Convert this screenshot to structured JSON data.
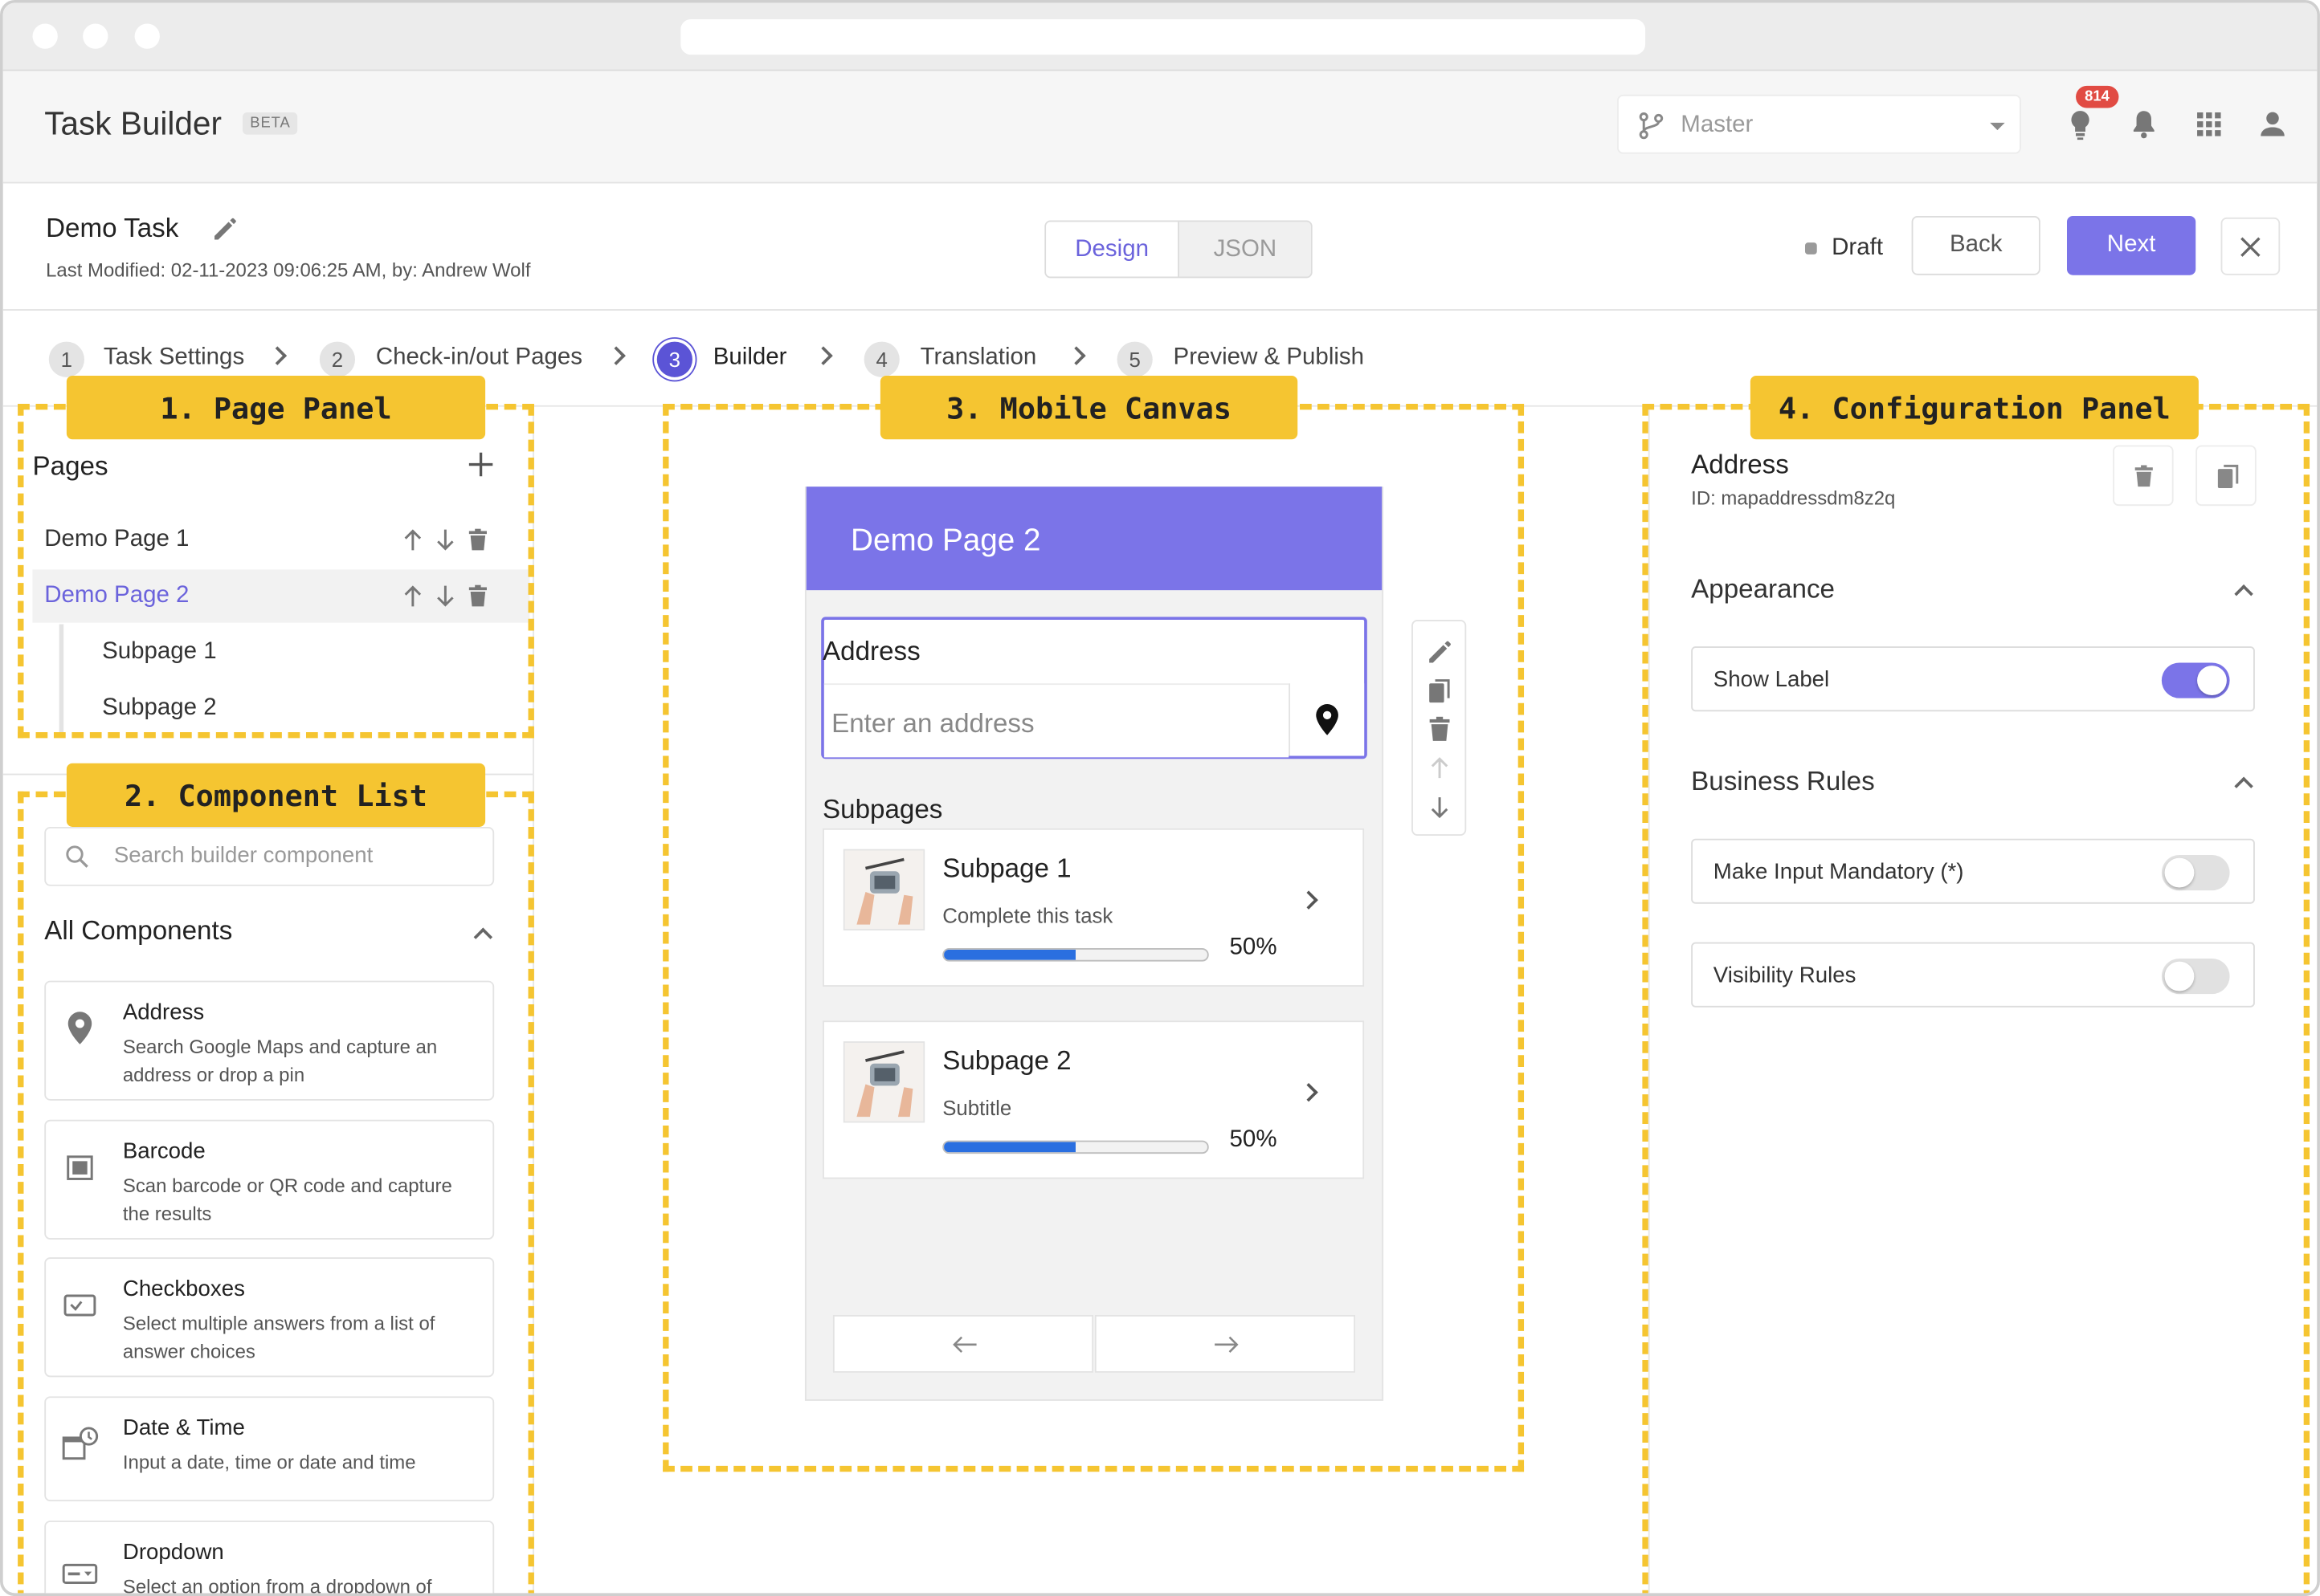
{
  "app": {
    "title": "Task Builder",
    "beta": "BETA",
    "branch": "Master",
    "notification_count": "814"
  },
  "task": {
    "name": "Demo Task",
    "last_modified": "Last Modified: 02-11-2023 09:06:25 AM, by: Andrew Wolf",
    "status": "Draft"
  },
  "view_toggle": {
    "design": "Design",
    "json": "JSON"
  },
  "actions": {
    "back": "Back",
    "next": "Next"
  },
  "steps": [
    {
      "num": "1",
      "label": "Task Settings"
    },
    {
      "num": "2",
      "label": "Check-in/out Pages"
    },
    {
      "num": "3",
      "label": "Builder"
    },
    {
      "num": "4",
      "label": "Translation"
    },
    {
      "num": "5",
      "label": "Preview & Publish"
    }
  ],
  "callouts": {
    "page_panel": "1. Page Panel",
    "component_list": "2. Component List",
    "mobile_canvas": "3. Mobile Canvas",
    "config_panel": "4. Configuration Panel"
  },
  "page_panel": {
    "title": "Pages",
    "pages": [
      {
        "label": "Demo Page 1"
      },
      {
        "label": "Demo Page 2"
      }
    ],
    "subpages": [
      {
        "label": "Subpage 1"
      },
      {
        "label": "Subpage 2"
      }
    ]
  },
  "component_list": {
    "search_placeholder": "Search builder component",
    "section_title": "All Components",
    "items": [
      {
        "title": "Address",
        "desc": "Search Google Maps and capture an address or drop a pin",
        "icon": "map-pin-icon"
      },
      {
        "title": "Barcode",
        "desc": "Scan barcode or QR code and capture the results",
        "icon": "barcode-icon"
      },
      {
        "title": "Checkboxes",
        "desc": "Select multiple answers from a list of answer choices",
        "icon": "checkbox-icon"
      },
      {
        "title": "Date & Time",
        "desc": "Input a date, time or date and time",
        "icon": "calendar-clock-icon"
      },
      {
        "title": "Dropdown",
        "desc": "Select an option from a dropdown of",
        "icon": "dropdown-icon"
      }
    ]
  },
  "canvas": {
    "page_title": "Demo Page 2",
    "address_label": "Address",
    "address_placeholder": "Enter an address",
    "subpages_label": "Subpages",
    "subpages": [
      {
        "title": "Subpage 1",
        "subtitle": "Complete this task",
        "progress": 0.5,
        "progress_label": "50%"
      },
      {
        "title": "Subpage 2",
        "subtitle": "Subtitle",
        "progress": 0.5,
        "progress_label": "50%"
      }
    ]
  },
  "config_panel": {
    "title": "Address",
    "id": "ID: mapaddressdm8z2q",
    "appearance": "Appearance",
    "show_label": "Show Label",
    "show_label_on": true,
    "business_rules": "Business Rules",
    "mandatory": "Make Input Mandatory (*)",
    "mandatory_on": false,
    "visibility": "Visibility Rules",
    "visibility_on": false
  },
  "colors": {
    "accent": "#7b74e8",
    "callout": "#f5c531",
    "progress": "#2a6fe0",
    "badge": "#e14b43"
  }
}
